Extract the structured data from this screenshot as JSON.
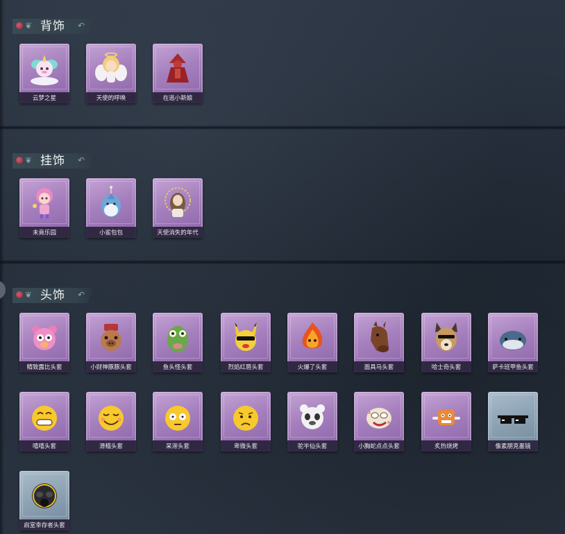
{
  "sections": {
    "back": {
      "title": "背饰",
      "items": [
        {
          "name": "云梦之星",
          "icon": "unicorn-plush-icon"
        },
        {
          "name": "天使的呼唤",
          "icon": "angel-doll-icon"
        },
        {
          "name": "在逃小新娘",
          "icon": "red-bride-doll-icon"
        }
      ]
    },
    "hanging": {
      "title": "挂饰",
      "items": [
        {
          "name": "未竟乐园",
          "icon": "pink-doll-icon"
        },
        {
          "name": "小鲨包包",
          "icon": "shark-bag-icon"
        },
        {
          "name": "天使消失的年代",
          "icon": "angel-portrait-icon"
        }
      ]
    },
    "head": {
      "title": "头饰",
      "items": [
        {
          "name": "精致露比头套",
          "icon": "pink-bear-head-icon"
        },
        {
          "name": "小财神豚豚头套",
          "icon": "pig-head-icon"
        },
        {
          "name": "鱼头怪头套",
          "icon": "fish-head-icon"
        },
        {
          "name": "烈焰红唇头套",
          "icon": "pikachu-head-icon"
        },
        {
          "name": "火爆了头套",
          "icon": "fire-head-icon"
        },
        {
          "name": "面具马头套",
          "icon": "horse-head-icon"
        },
        {
          "name": "哈士奇头套",
          "icon": "husky-head-icon"
        },
        {
          "name": "萨卡班甲鱼头套",
          "icon": "sacabambaspis-head-icon"
        },
        {
          "name": "嘻嘻头套",
          "icon": "grin-emoji-icon"
        },
        {
          "name": "滑稽头套",
          "icon": "funny-emoji-icon"
        },
        {
          "name": "呆滞头套",
          "icon": "dazed-emoji-icon"
        },
        {
          "name": "卑微头套",
          "icon": "humble-emoji-icon"
        },
        {
          "name": "驼半仙头套",
          "icon": "panda-head-icon"
        },
        {
          "name": "小胸蛇点点头套",
          "icon": "snake-head-icon"
        },
        {
          "name": "炙热烧烤",
          "icon": "bbq-head-icon"
        },
        {
          "name": "像素朋克墨镜",
          "icon": "pixel-sunglasses-icon"
        },
        {
          "name": "启室幸存者头套",
          "icon": "gas-mask-icon"
        }
      ]
    }
  },
  "colors": {
    "purple_card": "#a57fbd",
    "blue_card": "#8ea3b4",
    "background": "#26303d"
  }
}
